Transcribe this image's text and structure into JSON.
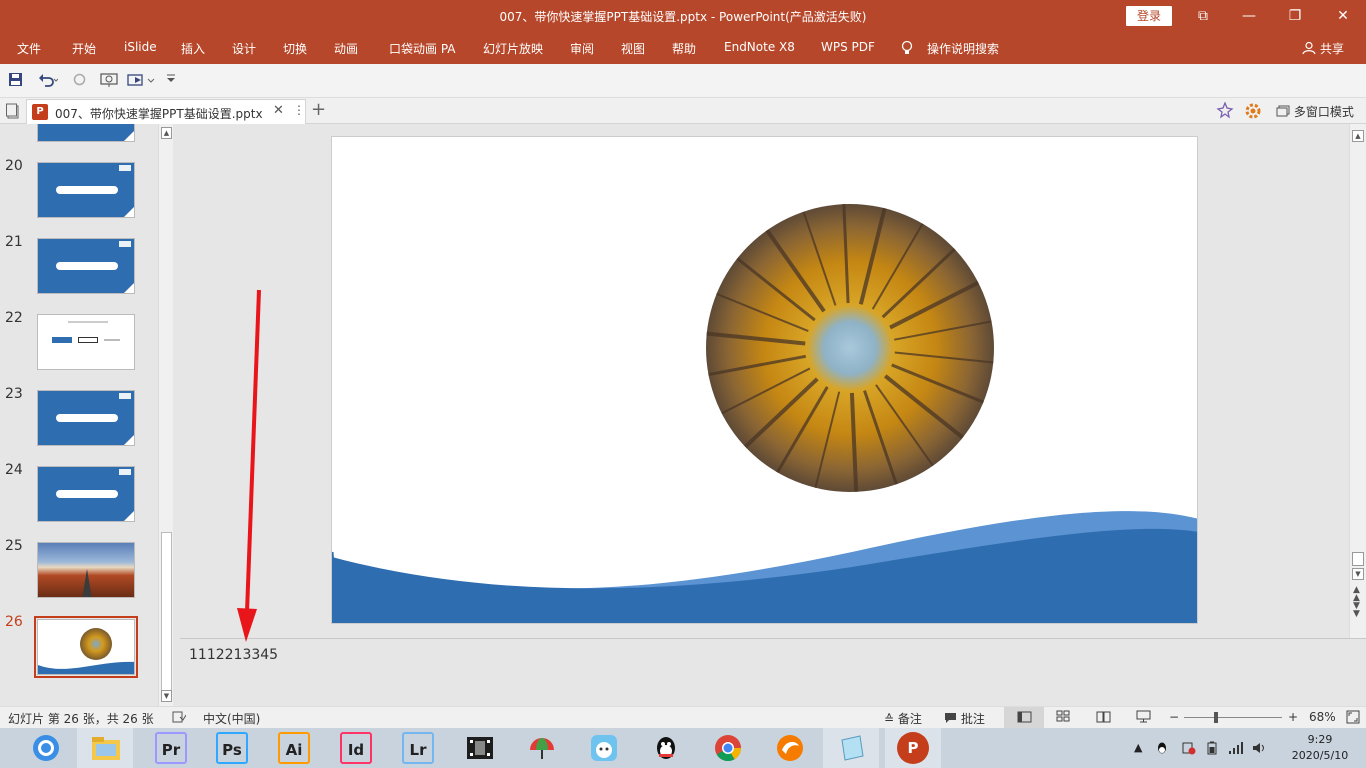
{
  "window": {
    "title": "007、带你快速掌握PPT基础设置.pptx  -  PowerPoint(产品激活失败)",
    "login_label": "登录",
    "controls": [
      "⧉",
      "—",
      "❐",
      "✕"
    ]
  },
  "ribbon": {
    "tabs": [
      "文件",
      "开始",
      "iSlide",
      "插入",
      "设计",
      "切换",
      "动画",
      "口袋动画 PA",
      "幻灯片放映",
      "审阅",
      "视图",
      "帮助",
      "EndNote X8",
      "WPS PDF"
    ],
    "search_label": "操作说明搜索",
    "share_label": "共享"
  },
  "quick_access": {
    "icons": [
      "save-icon",
      "undo-icon",
      "redo-icon",
      "present-from-start-icon",
      "present-dropdown-icon",
      "customize-icon"
    ]
  },
  "doc_tabs": {
    "active_tab": "007、带你快速掌握PPT基础设置.pptx",
    "close_glyph": "✕",
    "more_glyph": "⋮",
    "add_glyph": "+",
    "multi_window_label": "多窗口模式"
  },
  "thumbnails": [
    {
      "number": "20",
      "kind": "blue"
    },
    {
      "number": "21",
      "kind": "blue"
    },
    {
      "number": "22",
      "kind": "white"
    },
    {
      "number": "23",
      "kind": "blue"
    },
    {
      "number": "24",
      "kind": "blue"
    },
    {
      "number": "25",
      "kind": "road"
    },
    {
      "number": "26",
      "kind": "current"
    }
  ],
  "notes": {
    "text": "1112213345"
  },
  "status": {
    "slide_info": "幻灯片 第 26 张，共 26 张",
    "language": "中文(中国)",
    "notes_label": "备注",
    "comments_label": "批注",
    "zoom_minus": "−",
    "zoom_plus": "+",
    "zoom_value": "68%"
  },
  "taskbar": {
    "apps": [
      {
        "name": "Pr",
        "bg": "#2a0a3a",
        "fg": "#e58bff"
      },
      {
        "name": "Ps",
        "bg": "#001e36",
        "fg": "#31a8ff"
      },
      {
        "name": "Ai",
        "bg": "#330000",
        "fg": "#ff9a00"
      },
      {
        "name": "Id",
        "bg": "#49021f",
        "fg": "#ff3366"
      },
      {
        "name": "Lr",
        "bg": "#001a33",
        "fg": "#74b6f0"
      }
    ],
    "time": "9:29",
    "date": "2020/5/10"
  },
  "colors": {
    "accent": "#b7472a",
    "slide_blue": "#2f6db1",
    "slide_blue_light": "#5b93d3",
    "arrow_red": "#e8161b"
  }
}
